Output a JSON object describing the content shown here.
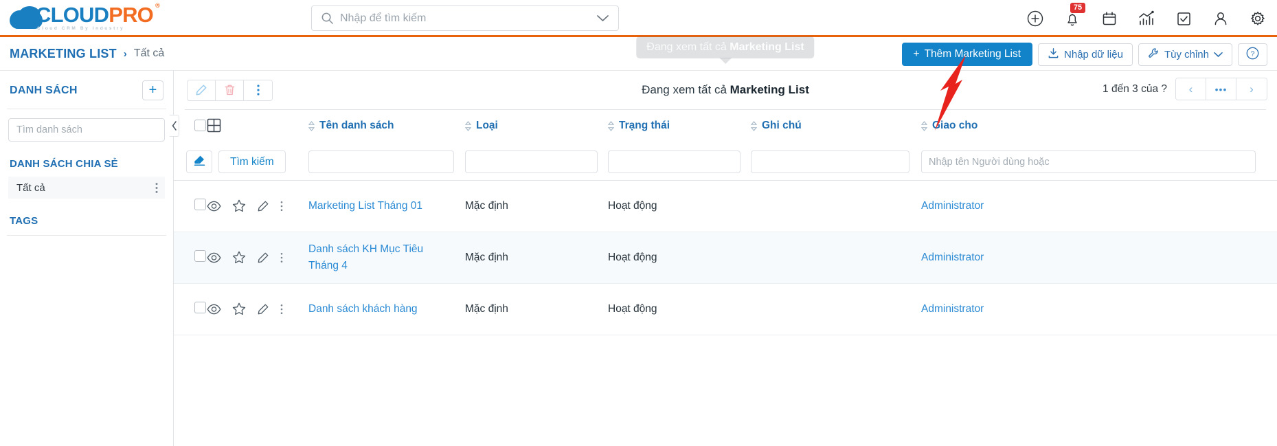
{
  "header": {
    "logo": {
      "part1": "CLOUD",
      "part2": "PRO",
      "reg": "®",
      "tagline": "Cloud CRM By Industry"
    },
    "search": {
      "placeholder": "Nhập để tìm kiếm",
      "value": ""
    },
    "icons": [
      {
        "name": "add-circle-icon"
      },
      {
        "name": "bell-icon",
        "badge": "75"
      },
      {
        "name": "calendar-icon"
      },
      {
        "name": "analytics-icon"
      },
      {
        "name": "task-check-icon"
      },
      {
        "name": "user-icon"
      },
      {
        "name": "gear-icon"
      }
    ]
  },
  "breadcrumb": {
    "module": "MARKETING LIST",
    "separator": "›",
    "current": "Tất cả"
  },
  "actions": {
    "add_label": "Thêm Marketing List",
    "add_plus": "+",
    "import_label": "Nhập dữ liệu",
    "customize_label": "Tùy chỉnh",
    "help_label": "?"
  },
  "sidebar": {
    "title": "DANH SÁCH",
    "add_label": "+",
    "search_placeholder": "Tìm danh sách",
    "shared_section": "DANH SÁCH CHIA SẺ",
    "shared_items": [
      {
        "label": "Tất cả"
      }
    ],
    "tags_section": "TAGS"
  },
  "main": {
    "tooltip_prefix": "Đang xem tất cả ",
    "tooltip_strong": "Marketing List",
    "view_prefix": "Đang xem tất cả ",
    "view_strong": "Marketing List",
    "pager_text": "1 đến 3 của ?",
    "pager_prev": "‹",
    "pager_dots": "•••",
    "pager_next": "›"
  },
  "table": {
    "columns": [
      {
        "key": "name",
        "label": "Tên danh sách"
      },
      {
        "key": "type",
        "label": "Loại"
      },
      {
        "key": "status",
        "label": "Trạng thái"
      },
      {
        "key": "note",
        "label": "Ghi chú"
      },
      {
        "key": "owner",
        "label": "Giao cho"
      }
    ],
    "filters": {
      "eraser_label": "",
      "search_label": "Tìm kiếm",
      "name_value": "",
      "type_value": "",
      "status_value": "",
      "note_value": "",
      "owner_placeholder": "Nhập tên Người dùng hoặc"
    },
    "rows": [
      {
        "name": "Marketing List Tháng 01",
        "type": "Mặc định",
        "status": "Hoạt động",
        "note": "",
        "owner": "Administrator"
      },
      {
        "name": "Danh sách KH Mục Tiêu Tháng 4",
        "type": "Mặc định",
        "status": "Hoạt động",
        "note": "",
        "owner": "Administrator"
      },
      {
        "name": "Danh sách khách hàng",
        "type": "Mặc định",
        "status": "Hoạt động",
        "note": "",
        "owner": "Administrator"
      }
    ]
  },
  "colors": {
    "brand_orange": "#e8620c",
    "brand_blue": "#1a7fc1",
    "primary_button": "#1283c8",
    "link": "#2a8ad4",
    "badge_red": "#e03131",
    "annotation_red": "#e8231d"
  }
}
